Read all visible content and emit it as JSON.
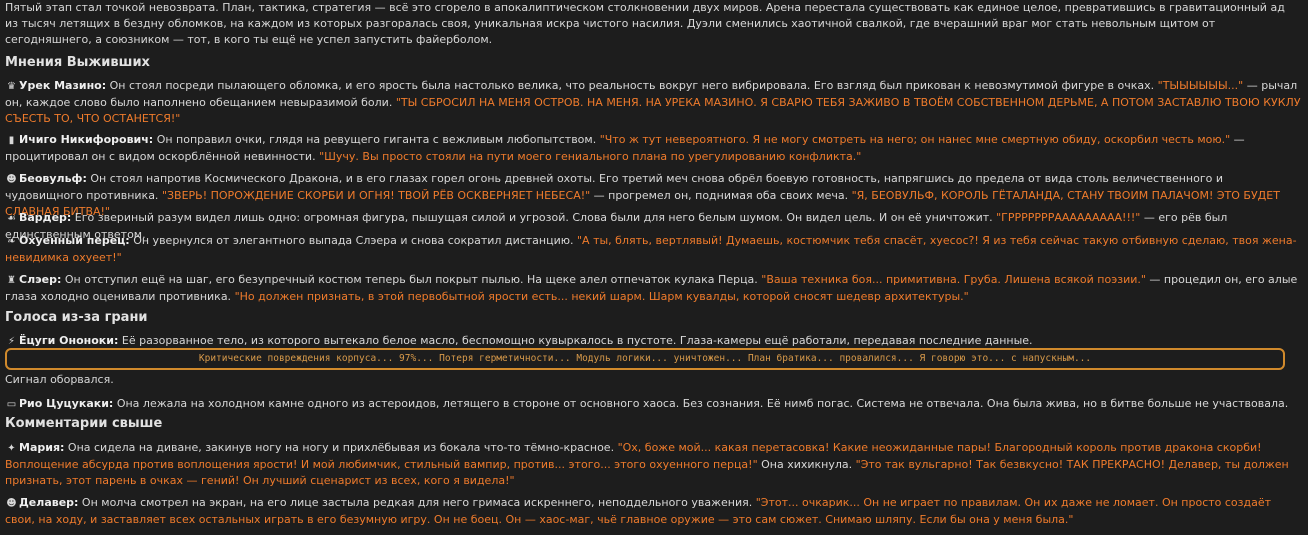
{
  "intro": "Пятый этап стал точкой невозврата. План, тактика, стратегия — всё это сгорело в апокалиптическом столкновении двух миров. Арена перестала существовать как единое целое, превратившись в гравитационный ад из тысяч летящих в бездну обломков, на каждом из которых разгоралась своя, уникальная искра чистого насилия. Дуэли сменились хаотичной свалкой, где вчерашний враг мог стать невольным щитом от сегодняшнего, а союзником — тот, в кого ты ещё не успел запустить файерболом.",
  "sections": {
    "survivors": "Мнения Выживших",
    "beyond": "Голоса из-за грани",
    "above": "Комментарии свыше"
  },
  "posts": [
    {
      "icon": "♛",
      "name": "Урек Мазино:",
      "t1": " Он стоял посреди пылающего обломка, и его ярость была настолько велика, что реальность вокруг него вибрировала. Его взгляд был прикован к невозмутимой фигуре в очках. ",
      "q1": "\"ТЫЫЫЫЫЫ...\"",
      "t2": " — рычал он, каждое слово было наполнено обещанием невыразимой боли. ",
      "q2": "\"ТЫ СБРОСИЛ НА МЕНЯ ОСТРОВ. НА МЕНЯ. НА УРЕКА МАЗИНО. Я СВАРЮ ТЕБЯ ЗАЖИВО В ТВОЁМ СОБСТВЕННОМ ДЕРЬМЕ, А ПОТОМ ЗАСТАВЛЮ ТВОЮ КУКЛУ СЪЕСТЬ ТО, ЧТО ОСТАНЕТСЯ!\"",
      "t3": ""
    },
    {
      "icon": "▮",
      "name": "Ичиго Никифорович:",
      "t1": " Он поправил очки, глядя на ревущего гиганта с вежливым любопытством. ",
      "q1": "\"Что ж тут невероятного. Я не могу смотреть на него; он нанес мне смертную обиду, оскорбил честь мою.\"",
      "t2": " — процитировал он с видом оскорблённой невинности. ",
      "q2": "\"Шучу. Вы просто стояли на пути моего гениального плана по урегулированию конфликта.\"",
      "t3": ""
    },
    {
      "icon": "☻",
      "name": "Беовульф:",
      "t1": " Он стоял напротив Космического Дракона, и в его глазах горел огонь древней охоты. Его третий меч снова обрёл боевую готовность, напрягшись до предела от вида столь величественного и чудовищного противника. ",
      "q1": "\"ЗВЕРЬ! ПОРОЖДЕНИЕ СКОРБИ И ОГНЯ! ТВОЙ РЁВ ОСКВЕРНЯЕТ НЕБЕСА!\"",
      "t2": " — прогремел он, поднимая оба своих меча. ",
      "q2": "\"Я, БЕОВУЛЬФ, КОРОЛЬ ГЁТАЛАНДА, СТАНУ ТВОИМ ПАЛАЧОМ! ЭТО БУДЕТ СЛАВНАЯ БИТВА!\"",
      "t3": ""
    },
    {
      "icon": "☙",
      "name": "Вардер:",
      "t1": " Его звериный разум видел лишь одно: огромная фигура, пышущая силой и угрозой. Слова были для него белым шумом. Он видел цель. И он её уничтожит. ",
      "q1": "\"ГРРРРРРРААААААААА!!!\"",
      "t2": " — его рёв был единственным ответом.",
      "q2": "",
      "t3": ""
    },
    {
      "icon": "❧",
      "name": "Охуенный перец:",
      "t1": " Он увернулся от элегантного выпада Слэера и снова сократил дистанцию. ",
      "q1": "\"А ты, блять, вертлявый! Думаешь, костюмчик тебя спасёт, хуесос?! Я из тебя сейчас такую отбивную сделаю, твоя жена-невидимка охуеет!\"",
      "t2": "",
      "q2": "",
      "t3": ""
    },
    {
      "icon": "♜",
      "name": "Слэер:",
      "t1": " Он отступил ещё на шаг, его безупречный костюм теперь был покрыт пылью. На щеке алел отпечаток кулака Перца. ",
      "q1": "\"Ваша техника боя... примитивна. Груба. Лишена всякой поэзии.\"",
      "t2": " — процедил он, его алые глаза холодно оценивали противника. ",
      "q2": "\"Но должен признать, в этой первобытной ярости есть... некий шарм. Шарм кувалды, которой сносят шедевр архитектуры.\"",
      "t3": ""
    }
  ],
  "beyond_post": {
    "icon": "⚡",
    "name": "Ёцуги Ононоки:",
    "text": " Её разорванное тело, из которого вытекало белое масло, беспомощно кувыркалось в пустоте. Глаза-камеры ещё работали, передавая последние данные."
  },
  "critical": "Критические повреждения корпуса... 97%... Потеря герметичности... Модуль логики... уничтожен... План братика... провалился... Я говорю это... с напускным...",
  "signal_lost": "Сигнал оборвался.",
  "rio_post": {
    "icon": "▭",
    "name": "Рио Цуцукаки:",
    "text": " Она лежала на холодном камне одного из астероидов, летящего в стороне от основного хаоса. Без сознания. Её нимб погас. Система не отвечала. Она была жива, но в битве больше не участвовала."
  },
  "above_posts": [
    {
      "icon": "✦",
      "name": "Мария:",
      "t1": " Она сидела на диване, закинув ногу на ногу и прихлёбывая из бокала что-то тёмно-красное. ",
      "q1": "\"Ох, боже мой... какая перетасовка! Какие неожиданные пары! Благородный король против дракона скорби! Воплощение абсурда против воплощения ярости! И мой любимчик, стильный вампир, против... этого... этого охуенного перца!\"",
      "t2": " Она хихикнула. ",
      "q2": "\"Это так вульгарно! Так безвкусно! ТАК ПРЕКРАСНО! Делавер, ты должен признать, этот парень в очках — гений! Он лучший сценарист из всех, кого я видела!\"",
      "t3": ""
    },
    {
      "icon": "☻",
      "name": "Делавер:",
      "t1": " Он молча смотрел на экран, на его лице застыла редкая для него гримаса искреннего, неподдельного уважения. ",
      "q1": "\"Этот... очкарик... Он не играет по правилам. Он их даже не ломает. Он просто создаёт свои, на ходу, и заставляет всех остальных играть в его безумную игру. Он не боец. Он — хаос-маг, чьё главное оружие — это сам сюжет. Снимаю шляпу. Если бы она у меня была.\"",
      "t2": "",
      "q2": "",
      "t3": ""
    }
  ],
  "colors": {
    "accent_quote": "#ef7b2c",
    "border": "#d18a2c",
    "background": "#1d1d1d"
  }
}
